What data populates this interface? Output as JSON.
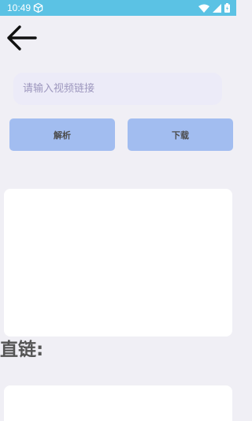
{
  "status_bar": {
    "time": "10:49",
    "icons": [
      "cube-icon",
      "wifi-icon",
      "signal-icon",
      "battery-icon"
    ],
    "color": "#5bc2e4"
  },
  "nav": {
    "back_icon": "arrow-left-icon"
  },
  "input": {
    "value": "",
    "placeholder": "请输入视频链接"
  },
  "buttons": {
    "parse_label": "解析",
    "download_label": "下载",
    "color": "#a2bdf0"
  },
  "direct_link": {
    "label": "直链:"
  }
}
